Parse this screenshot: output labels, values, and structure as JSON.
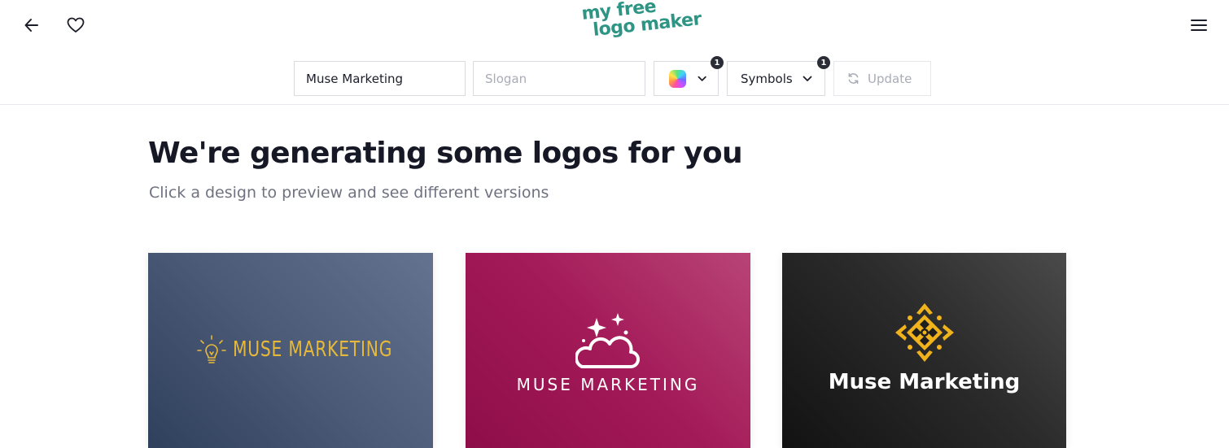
{
  "header": {
    "brand_line1": "my free",
    "brand_line2": "logo maker",
    "brand_color": "#2e9585",
    "icons": [
      "arrow-left-icon",
      "heart-icon",
      "hamburger-menu-icon"
    ]
  },
  "toolbar": {
    "company_name_value": "Muse Marketing",
    "slogan_placeholder": "Slogan",
    "color_badge": "1",
    "symbols_label": "Symbols",
    "symbols_badge": "1",
    "update_label": "Update"
  },
  "main": {
    "title": "We're generating some logos for you",
    "subtitle": "Click a design to preview and see different versions"
  },
  "cards": [
    {
      "text": "MUSE MARKETING",
      "icon": "lightbulb-icon",
      "accent": "#e7b93a"
    },
    {
      "text": "MUSE MARKETING",
      "icon": "cloud-sparkles-icon",
      "accent": "#ffffff"
    },
    {
      "text": "Muse Marketing",
      "icon": "ornament-icon",
      "accent": "#f1b31c"
    }
  ]
}
